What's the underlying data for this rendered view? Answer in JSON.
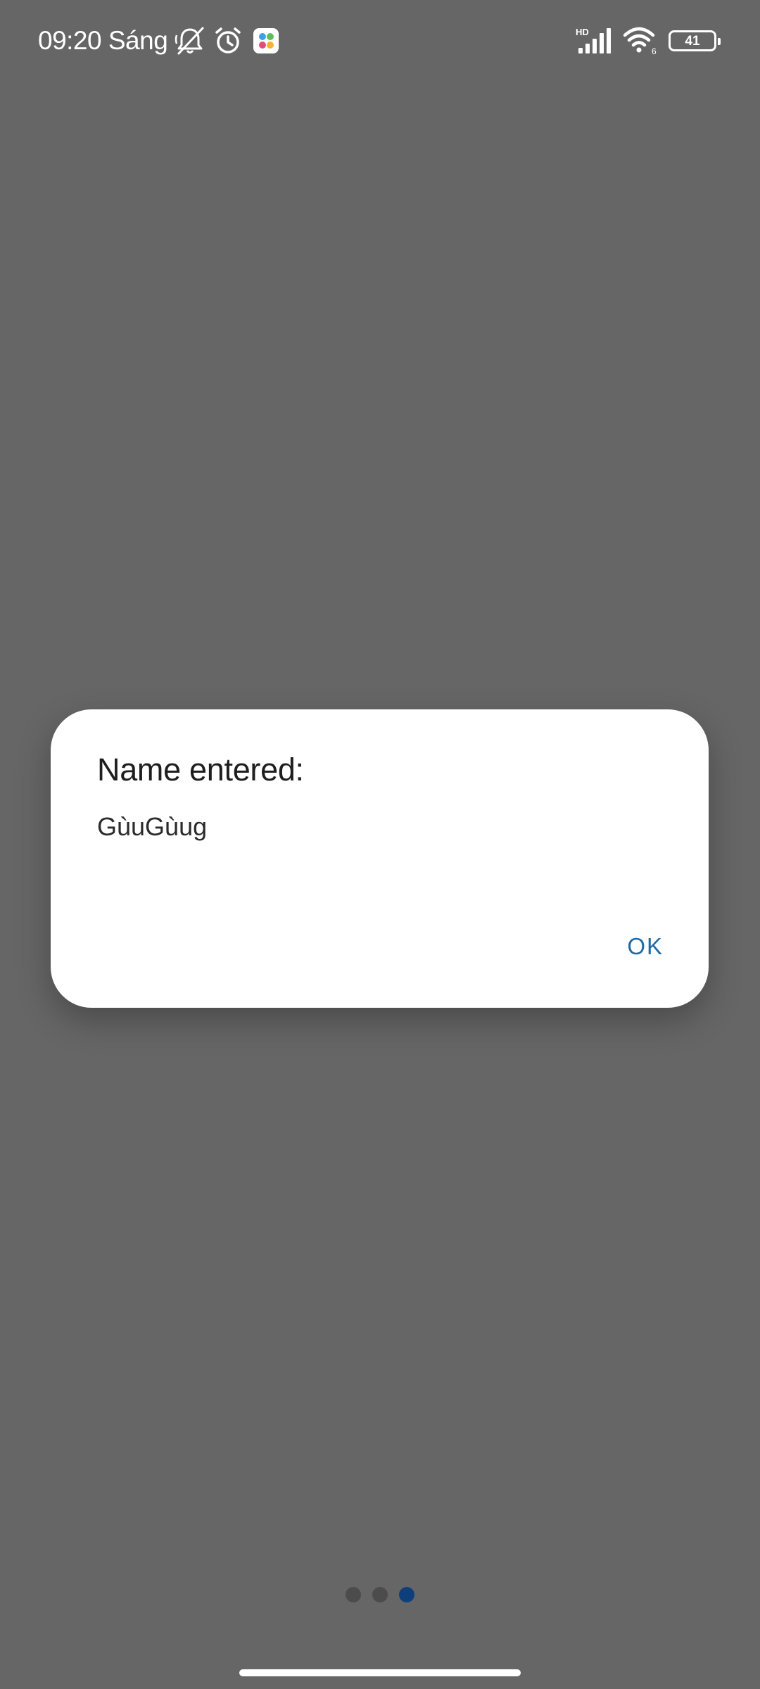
{
  "status_bar": {
    "time": "09:20 Sáng",
    "icons_left": [
      "bell-off-icon",
      "alarm-icon",
      "app-notification-icon"
    ],
    "network_type": "HD",
    "wifi_badge": "6",
    "battery_level": "41"
  },
  "dialog": {
    "title": "Name entered:",
    "message": "GùuGùug",
    "ok_label": "OK"
  },
  "page_indicator": {
    "total": 3,
    "active_index": 2
  },
  "colors": {
    "background": "#666666",
    "dialog_bg": "#ffffff",
    "accent": "#1f6aa5",
    "active_dot": "#0f3f7a"
  }
}
